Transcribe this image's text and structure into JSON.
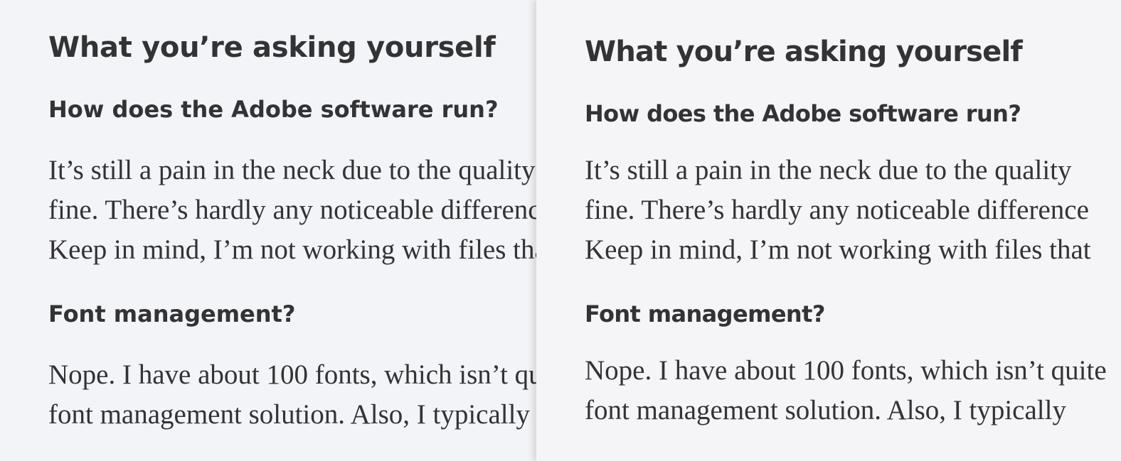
{
  "article": {
    "heading": "What you’re asking yourself",
    "q1": "How does the Adobe software run?",
    "p1_lines": [
      "It’s still a pain in the neck due to the quality",
      "fine. There’s hardly any noticeable difference",
      "Keep in mind, I’m not working with files that"
    ],
    "q2": "Font management?",
    "p2_lines": [
      "Nope. I have about 100 fonts, which isn’t quite",
      "font management solution. Also, I typically"
    ]
  },
  "colors": {
    "background": "#f3f4f7",
    "text": "#333335"
  }
}
